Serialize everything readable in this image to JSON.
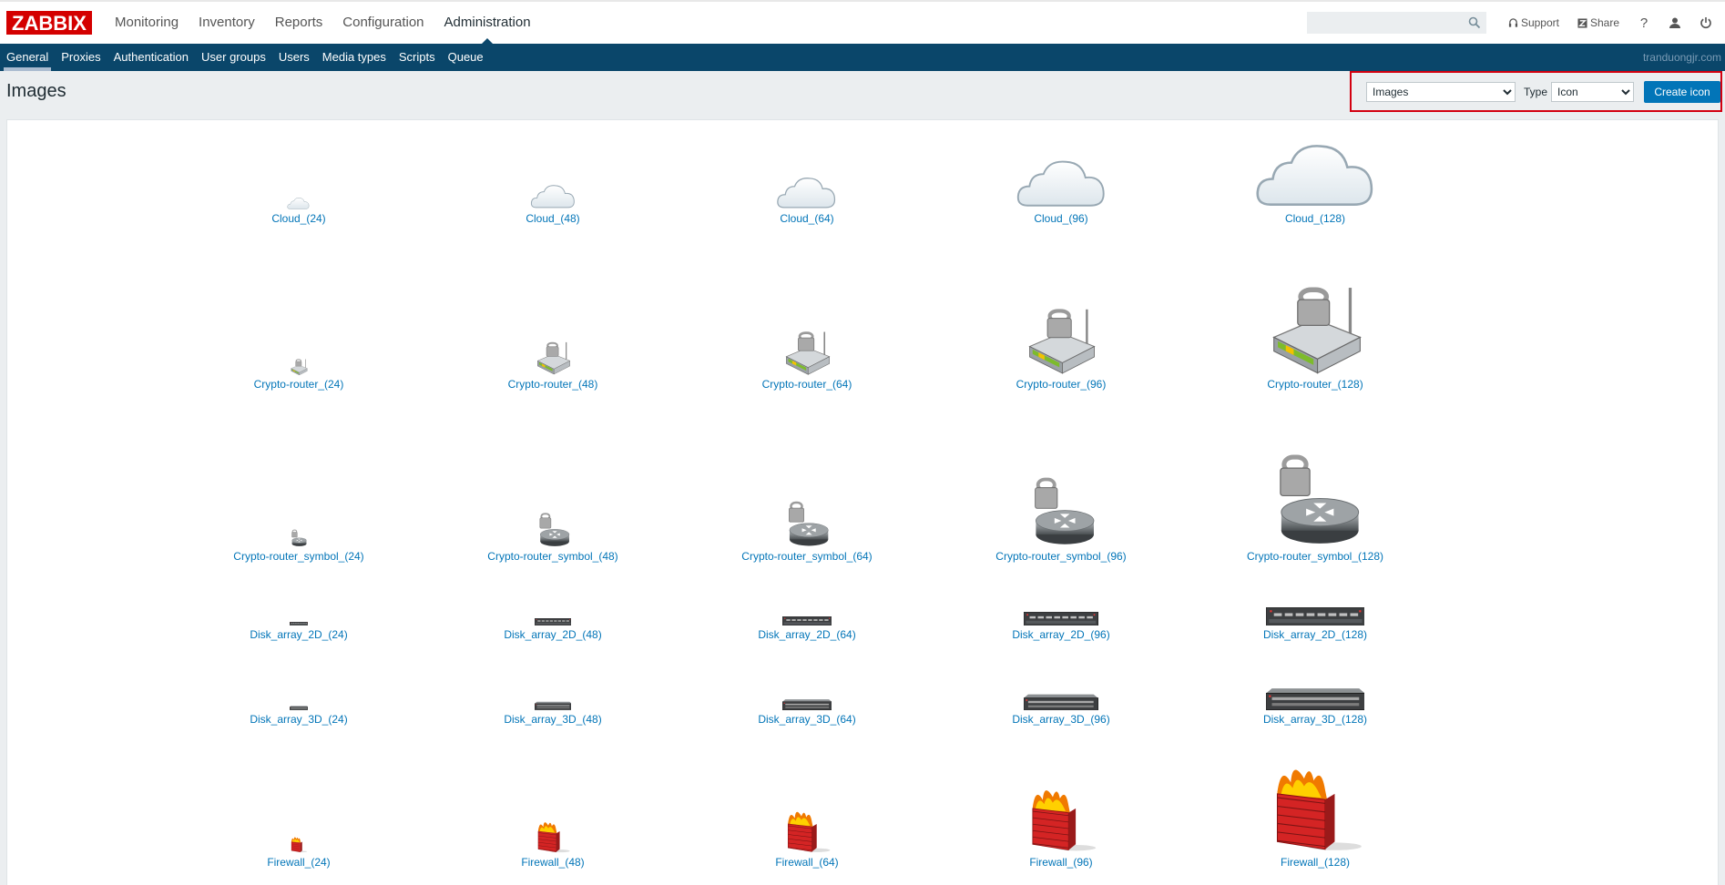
{
  "logo": "ZABBIX",
  "main_menu": [
    "Monitoring",
    "Inventory",
    "Reports",
    "Configuration",
    "Administration"
  ],
  "main_menu_active": "Administration",
  "tools": {
    "support": "Support",
    "share": "Share",
    "help": "?"
  },
  "search": {
    "placeholder": "",
    "value": ""
  },
  "sub_menu": [
    "General",
    "Proxies",
    "Authentication",
    "User groups",
    "Users",
    "Media types",
    "Scripts",
    "Queue"
  ],
  "sub_menu_active": "General",
  "server_name": "tranduongjr.com",
  "page_title": "Images",
  "controls": {
    "section_select": "Images",
    "type_label": "Type",
    "type_select": "Icon",
    "create_button": "Create icon"
  },
  "colors": {
    "brand": "#d40000",
    "nav": "#0a466a",
    "link": "#0275b8",
    "highlight_box": "#d30010"
  },
  "images": [
    {
      "icon": "cloud",
      "sizes": [
        {
          "label": "Cloud_(24)"
        },
        {
          "label": "Cloud_(48)"
        },
        {
          "label": "Cloud_(64)"
        },
        {
          "label": "Cloud_(96)"
        },
        {
          "label": "Cloud_(128)"
        }
      ]
    },
    {
      "icon": "crypto-router",
      "sizes": [
        {
          "label": "Crypto-router_(24)"
        },
        {
          "label": "Crypto-router_(48)"
        },
        {
          "label": "Crypto-router_(64)"
        },
        {
          "label": "Crypto-router_(96)"
        },
        {
          "label": "Crypto-router_(128)"
        }
      ]
    },
    {
      "icon": "crypto-router-symbol",
      "sizes": [
        {
          "label": "Crypto-router_symbol_(24)"
        },
        {
          "label": "Crypto-router_symbol_(48)"
        },
        {
          "label": "Crypto-router_symbol_(64)"
        },
        {
          "label": "Crypto-router_symbol_(96)"
        },
        {
          "label": "Crypto-router_symbol_(128)"
        }
      ]
    },
    {
      "icon": "disk-array-2d",
      "sizes": [
        {
          "label": "Disk_array_2D_(24)"
        },
        {
          "label": "Disk_array_2D_(48)"
        },
        {
          "label": "Disk_array_2D_(64)"
        },
        {
          "label": "Disk_array_2D_(96)"
        },
        {
          "label": "Disk_array_2D_(128)"
        }
      ]
    },
    {
      "icon": "disk-array-3d",
      "sizes": [
        {
          "label": "Disk_array_3D_(24)"
        },
        {
          "label": "Disk_array_3D_(48)"
        },
        {
          "label": "Disk_array_3D_(64)"
        },
        {
          "label": "Disk_array_3D_(96)"
        },
        {
          "label": "Disk_array_3D_(128)"
        }
      ]
    },
    {
      "icon": "firewall",
      "sizes": [
        {
          "label": "Firewall_(24)"
        },
        {
          "label": "Firewall_(48)"
        },
        {
          "label": "Firewall_(64)"
        },
        {
          "label": "Firewall_(96)"
        },
        {
          "label": "Firewall_(128)"
        }
      ]
    }
  ]
}
